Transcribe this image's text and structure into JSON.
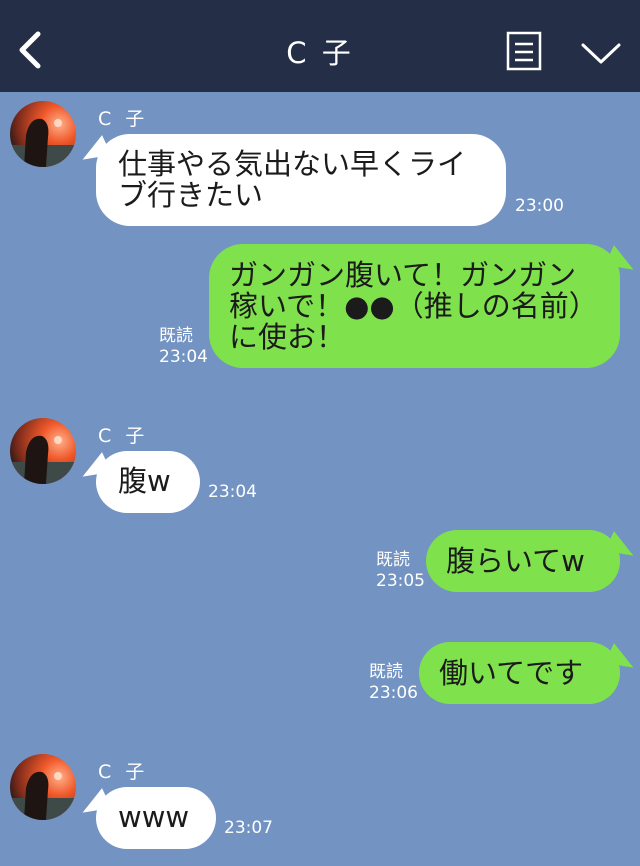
{
  "header": {
    "title": "C 子",
    "back_icon": "chevron-left-icon",
    "menu_icon": "document-menu-icon",
    "more_icon": "chevron-down-icon"
  },
  "colors": {
    "header_bg": "#242f47",
    "chat_bg": "#7393c2",
    "incoming_bubble": "#ffffff",
    "outgoing_bubble": "#7fe24d"
  },
  "messages": [
    {
      "direction": "in",
      "sender": "C 子",
      "text": "仕事やる気出ない早くライブ行きたい",
      "time": "23:00"
    },
    {
      "direction": "out",
      "text": "ガンガン腹いて！ガンガン稼いで！●●（推しの名前）に使お！",
      "read": "既読",
      "time": "23:04"
    },
    {
      "direction": "in",
      "sender": "C 子",
      "text": "腹w",
      "time": "23:04"
    },
    {
      "direction": "out",
      "text": "腹らいてw",
      "read": "既読",
      "time": "23:05"
    },
    {
      "direction": "out",
      "text": "働いてです",
      "read": "既読",
      "time": "23:06"
    },
    {
      "direction": "in",
      "sender": "C 子",
      "text": "www",
      "time": "23:07"
    }
  ]
}
